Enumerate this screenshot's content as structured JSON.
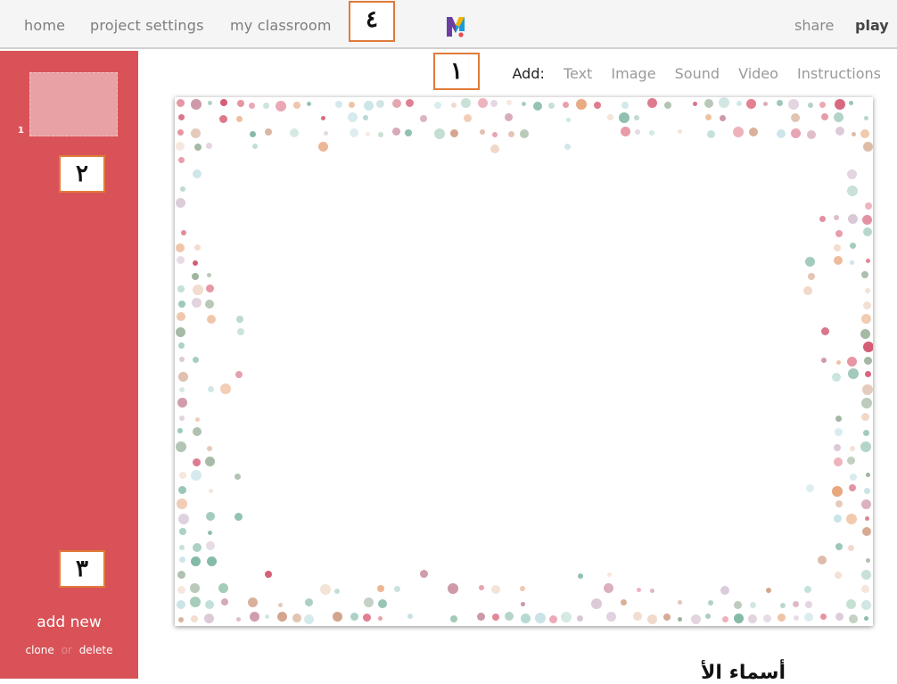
{
  "nav": {
    "home": "home",
    "project_settings": "project settings",
    "my_classroom": "my classroom",
    "share": "share",
    "play": "play"
  },
  "logo": {
    "letter": "M",
    "colors": [
      "#e84a4f",
      "#6b3fa0",
      "#f4b400",
      "#1a9bd7"
    ]
  },
  "add_bar": {
    "label": "Add:",
    "items": [
      "Text",
      "Image",
      "Sound",
      "Video",
      "Instructions"
    ]
  },
  "sidebar": {
    "slide_number": "1",
    "add_new": "add new",
    "clone": "clone",
    "or": "or",
    "delete": "delete"
  },
  "callouts": [
    "١",
    "٢",
    "٣",
    "٤"
  ],
  "bottom_text": "أسماء الأ",
  "colors": {
    "sidebar": "#d95257",
    "callout_border": "#e07b39",
    "dot_palette": [
      "#9fc9b5",
      "#e8a67c",
      "#d9c6d6",
      "#c98f9f",
      "#b7d9d3",
      "#e07a8c",
      "#9ab09a",
      "#f0d8c8",
      "#7fb7a3",
      "#d3a58c",
      "#c7e2e6",
      "#d45a73"
    ]
  }
}
